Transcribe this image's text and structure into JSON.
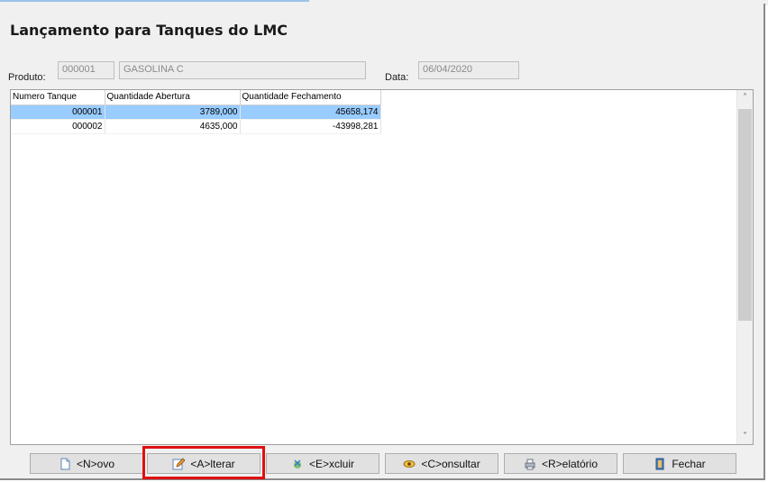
{
  "form": {
    "title": "Lançamento para Tanques do LMC",
    "produto_label": "Produto:",
    "produto_code": "000001",
    "produto_name": "GASOLINA C",
    "data_label": "Data:",
    "data_value": "06/04/2020"
  },
  "grid": {
    "columns": [
      "Numero Tanque",
      "Quantidade Abertura",
      "Quantidade Fechamento"
    ],
    "rows": [
      [
        "000001",
        "3789,000",
        "45658,174"
      ],
      [
        "000002",
        "4635,000",
        "-43998,281"
      ]
    ],
    "selected_row": 0
  },
  "buttons": [
    {
      "label": "<N>ovo",
      "icon": "new-document-icon"
    },
    {
      "label": "<A>lterar",
      "icon": "edit-pencil-icon"
    },
    {
      "label": "<E>xcluir",
      "icon": "delete-icon"
    },
    {
      "label": "<C>onsultar",
      "icon": "search-eye-icon"
    },
    {
      "label": "<R>elatório",
      "icon": "printer-icon"
    },
    {
      "label": "Fechar",
      "icon": "exit-door-icon"
    }
  ],
  "colors": {
    "selection": "#99ccff",
    "highlight_box": "#e01010"
  }
}
